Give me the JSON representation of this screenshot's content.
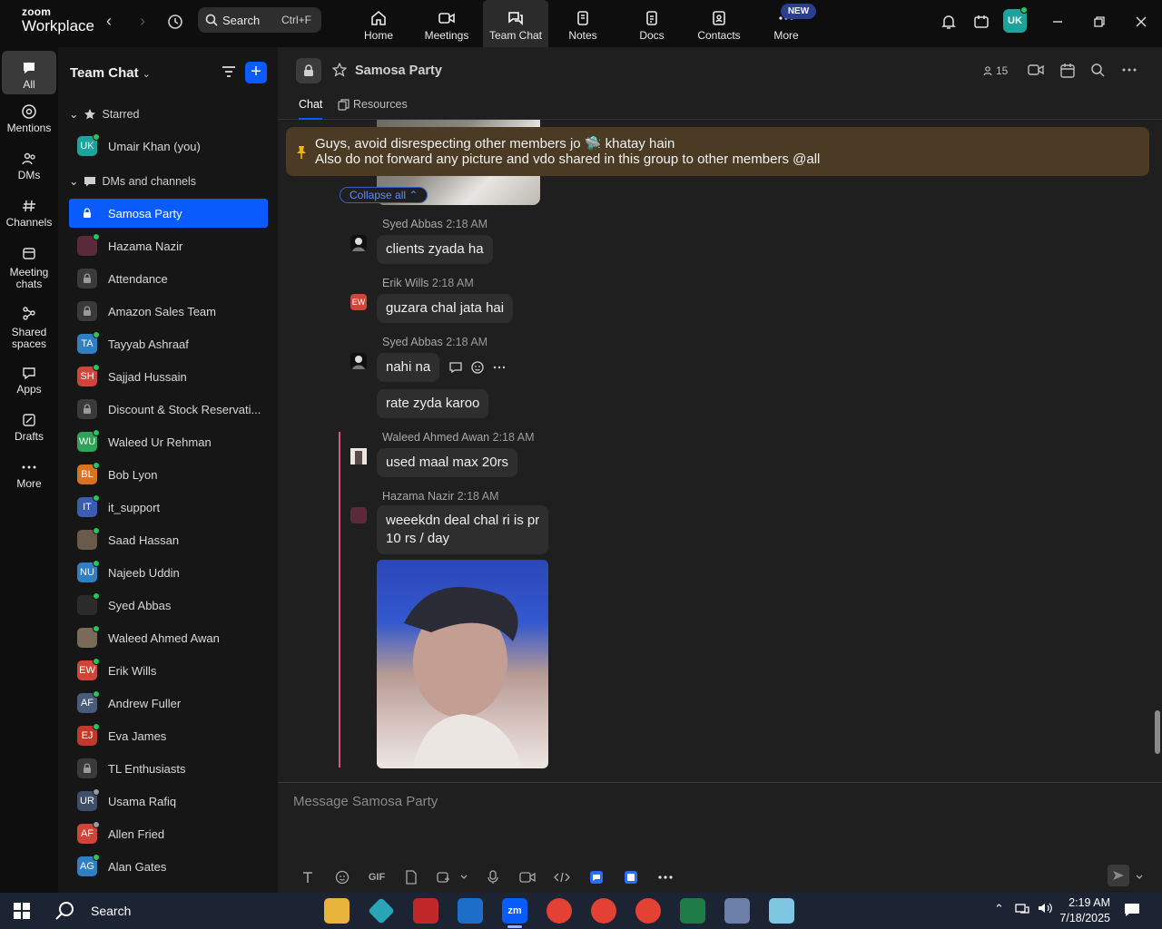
{
  "app": {
    "logo_line1": "zoom",
    "logo_line2": "Workplace"
  },
  "topbar": {
    "search_label": "Search",
    "search_shortcut": "Ctrl+F",
    "nav": [
      {
        "label": "Home",
        "icon": "home-icon"
      },
      {
        "label": "Meetings",
        "icon": "video-icon"
      },
      {
        "label": "Team Chat",
        "icon": "chat-icon",
        "active": true
      },
      {
        "label": "Notes",
        "icon": "notes-icon"
      },
      {
        "label": "Docs",
        "icon": "docs-icon"
      },
      {
        "label": "Contacts",
        "icon": "contacts-icon"
      },
      {
        "label": "More",
        "icon": "more-icon"
      }
    ],
    "new_badge": "NEW",
    "avatar_initials": "UK"
  },
  "rail": [
    {
      "label": "All",
      "icon": "chat-bubble-icon",
      "active": true
    },
    {
      "label": "Mentions",
      "icon": "at-icon"
    },
    {
      "label": "DMs",
      "icon": "people-icon"
    },
    {
      "label": "Channels",
      "icon": "hash-icon"
    },
    {
      "label": "Meeting chats",
      "icon": "calendar-chat-icon"
    },
    {
      "label": "Shared spaces",
      "icon": "share-nodes-icon"
    },
    {
      "label": "Apps",
      "icon": "apps-icon"
    },
    {
      "label": "Drafts",
      "icon": "drafts-icon"
    },
    {
      "label": "More",
      "icon": "ellipsis-icon"
    }
  ],
  "sidebar": {
    "title": "Team Chat",
    "starred_label": "Starred",
    "dms_label": "DMs and channels",
    "starred": [
      {
        "name": "Umair Khan (you)",
        "initials": "UK",
        "color": "#1ca39b",
        "presence": "#22c55e"
      }
    ],
    "items": [
      {
        "name": "Samosa Party",
        "type": "lock",
        "selected": true
      },
      {
        "name": "Hazama Nazir",
        "initials": "",
        "color": "#5a2a3a",
        "presence": "#22c55e"
      },
      {
        "name": "Attendance",
        "type": "lock"
      },
      {
        "name": "Amazon Sales Team",
        "type": "lock"
      },
      {
        "name": "Tayyab Ashraaf",
        "initials": "TA",
        "color": "#2f7fc2",
        "presence": "#22c55e"
      },
      {
        "name": "Sajjad Hussain",
        "initials": "SH",
        "color": "#d0443a",
        "presence": "#22c55e"
      },
      {
        "name": "Discount & Stock Reservati...",
        "type": "lock"
      },
      {
        "name": "Waleed Ur Rehman",
        "initials": "WU",
        "color": "#2fa35a",
        "presence": "#22c55e"
      },
      {
        "name": "Bob Lyon",
        "initials": "BL",
        "color": "#d9731f",
        "presence": "#22c55e"
      },
      {
        "name": "it_support",
        "initials": "IT",
        "color": "#3b5cb0",
        "presence": "#22c55e"
      },
      {
        "name": "Saad Hassan",
        "initials": "",
        "color": "#6b5a4a",
        "presence": "#22c55e"
      },
      {
        "name": "Najeeb Uddin",
        "initials": "NU",
        "color": "#2f7fc2",
        "presence": "#22c55e"
      },
      {
        "name": "Syed Abbas",
        "initials": "",
        "color": "#2b2b2b",
        "presence": "#22c55e"
      },
      {
        "name": "Waleed Ahmed Awan",
        "initials": "",
        "color": "#7a6a5a",
        "presence": "#22c55e"
      },
      {
        "name": "Erik Wills",
        "initials": "EW",
        "color": "#d0443a",
        "presence": "#22c55e"
      },
      {
        "name": "Andrew Fuller",
        "initials": "AF",
        "color": "#4a5a7a",
        "presence": "#22c55e"
      },
      {
        "name": "Eva James",
        "initials": "EJ",
        "color": "#c0392b",
        "presence": "#22c55e"
      },
      {
        "name": "TL Enthusiasts",
        "type": "lock"
      },
      {
        "name": "Usama Rafiq",
        "initials": "UR",
        "color": "#3f4f6a",
        "presence": "#9a9a9a"
      },
      {
        "name": "Allen Fried",
        "initials": "AF",
        "color": "#d0443a",
        "presence": "#9a9a9a"
      },
      {
        "name": "Alan Gates",
        "initials": "AG",
        "color": "#2f7fc2",
        "presence": "#22c55e"
      }
    ]
  },
  "channel": {
    "name": "Samosa Party",
    "members": "15",
    "tabs": [
      "Chat",
      "Resources"
    ],
    "pinned_line1": "Guys, avoid disrespecting other members jo 🛸 khatay hain",
    "pinned_line2": "Also do not forward any picture and vdo shared in this group to other members @all",
    "collapse_label": "Collapse all"
  },
  "messages": [
    {
      "sender": "Syed Abbas",
      "time": "2:18 AM",
      "text": "clients zyada ha"
    },
    {
      "sender": "Erik Wills",
      "time": "2:18 AM",
      "text": "guzara chal jata hai",
      "initials": "EW"
    },
    {
      "sender": "Syed Abbas",
      "time": "2:18 AM",
      "text": "nahi na"
    },
    {
      "text": "rate zyda karoo"
    },
    {
      "sender": "Waleed Ahmed Awan",
      "time": "2:18 AM",
      "text": "used maal max 20rs"
    },
    {
      "sender": "Hazama Nazir",
      "time": "2:18 AM",
      "text_line1": "weeekdn deal chal ri is pr",
      "text_line2": "10 rs / day"
    }
  ],
  "composer": {
    "placeholder": "Message Samosa Party",
    "gif_label": "GIF"
  },
  "taskbar": {
    "search_label": "Search",
    "time": "2:19 AM",
    "date": "7/18/2025"
  },
  "colors": {
    "accent": "#0b5cff",
    "pinned_bg": "#4b3b24",
    "thread_line": "#d9577a"
  }
}
